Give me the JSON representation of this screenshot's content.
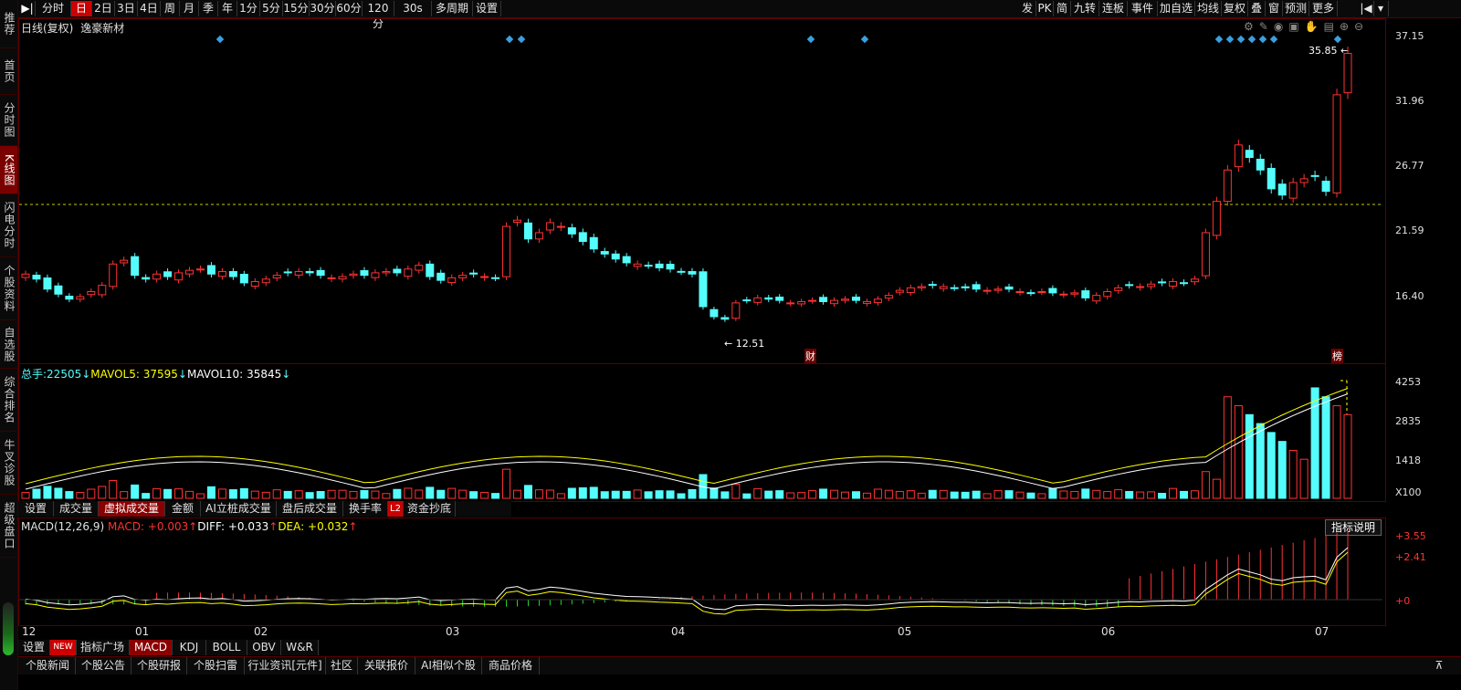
{
  "sidebar": {
    "items": [
      {
        "label": "推荐"
      },
      {
        "label": "首页"
      },
      {
        "label": "分时图"
      },
      {
        "label": "K线图"
      },
      {
        "label": "闪电分时"
      },
      {
        "label": "个股资料"
      },
      {
        "label": "自选股"
      },
      {
        "label": "综合排名"
      },
      {
        "label": "牛叉诊股"
      },
      {
        "label": "超级盘口"
      }
    ]
  },
  "toolbar": {
    "left": [
      "分时",
      "日",
      "2日",
      "3日",
      "4日",
      "周",
      "月",
      "季",
      "年",
      "1分",
      "5分",
      "15分",
      "30分",
      "60分",
      "120分",
      "30s",
      "多周期",
      "设置"
    ],
    "active": "日",
    "right": [
      "发",
      "PK",
      "简",
      "九转",
      "连板",
      "事件",
      "加自选",
      "均线",
      "复权",
      "叠",
      "窗",
      "预测",
      "更多"
    ]
  },
  "chart": {
    "title": "日线(复权)",
    "stock_name": "逸豪新材",
    "price_axis": [
      "37.15",
      "31.96",
      "26.77",
      "21.59",
      "16.40"
    ],
    "high_label": "35.85",
    "low_label": "12.51",
    "marker_cai": "财",
    "marker_bang": "榜"
  },
  "volume": {
    "label_total": "总手:",
    "total": "22505",
    "label_mavol5": "MAVOL5:",
    "mavol5": "37595",
    "label_mavol10": "MAVOL10:",
    "mavol10": "35845",
    "axis": [
      "4253",
      "2835",
      "1418",
      "X100"
    ],
    "tabs": [
      "设置",
      "成交量",
      "虚拟成交量",
      "金额",
      "AI立桩成交量",
      "盘后成交量",
      "换手率",
      "资金抄底"
    ],
    "active_tab": "虚拟成交量",
    "l2_badge": "L2"
  },
  "macd": {
    "title": "MACD(12,26,9)",
    "label_macd": "MACD:",
    "macd": "+0.003",
    "label_diff": "DIFF:",
    "diff": "+0.033",
    "label_dea": "DEA:",
    "dea": "+0.032",
    "axis": [
      "+3.55",
      "+2.41",
      "+0"
    ],
    "explain_button": "指标说明"
  },
  "xaxis": {
    "months": [
      "12",
      "01",
      "02",
      "03",
      "04",
      "05",
      "06",
      "07"
    ]
  },
  "indicator_tabs": {
    "items": [
      "设置",
      "指标广场",
      "MACD",
      "KDJ",
      "BOLL",
      "OBV",
      "W&R"
    ],
    "new_badge": "NEW",
    "active": "MACD"
  },
  "news_tabs": {
    "items": [
      "个股新闻",
      "个股公告",
      "个股研报",
      "个股扫雷",
      "行业资讯[元件]",
      "社区",
      "关联报价",
      "AI相似个股",
      "商品价格"
    ]
  },
  "colors": {
    "up": "#ff3232",
    "down": "#54fcfc",
    "ma5": "#ffff00",
    "ma10": "#ffffff",
    "accent": "#c00000"
  }
}
